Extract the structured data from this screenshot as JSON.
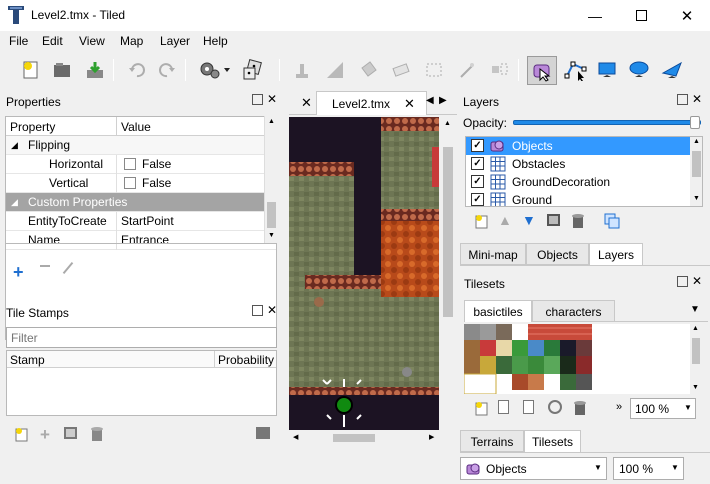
{
  "window": {
    "title": "Level2.tmx - Tiled",
    "min_glyph": "—",
    "max_glyph": "☐",
    "close_glyph": "✕"
  },
  "menu": [
    "File",
    "Edit",
    "View",
    "Map",
    "Layer",
    "Help"
  ],
  "properties": {
    "title": "Properties",
    "col_property": "Property",
    "col_value": "Value",
    "rows": {
      "flipping": "Flipping",
      "horizontal": "Horizontal",
      "horizontal_val": "False",
      "vertical": "Vertical",
      "vertical_val": "False",
      "custom": "Custom Properties",
      "entity": "EntityToCreate",
      "entity_val": "StartPoint",
      "name": "Name",
      "name_val": "Entrance"
    }
  },
  "tile_stamps": {
    "title": "Tile Stamps",
    "filter_placeholder": "Filter",
    "col_stamp": "Stamp",
    "col_probability": "Probability"
  },
  "editor": {
    "tab_label": "Level2.tmx"
  },
  "layers": {
    "title": "Layers",
    "opacity_label": "Opacity:",
    "opacity_value": 1.0,
    "items": [
      {
        "name": "Objects",
        "checked": true,
        "selected": true,
        "icon": "object-layer-icon"
      },
      {
        "name": "Obstacles",
        "checked": true,
        "selected": false,
        "icon": "tile-layer-icon"
      },
      {
        "name": "GroundDecoration",
        "checked": true,
        "selected": false,
        "icon": "tile-layer-icon"
      },
      {
        "name": "Ground",
        "checked": true,
        "selected": false,
        "icon": "tile-layer-icon"
      }
    ]
  },
  "layer_tabs": [
    "Mini-map",
    "Objects",
    "Layers"
  ],
  "tilesets": {
    "title": "Tilesets",
    "tabs": [
      "basictiles",
      "characters"
    ],
    "zoom": "100 %"
  },
  "bottom_tabs": [
    "Terrains",
    "Tilesets"
  ],
  "statusbar": {
    "layer_select": "Objects",
    "zoom": "100 %"
  },
  "colors": {
    "selection": "#3399ff",
    "accent_blue": "#1f6fd0"
  }
}
